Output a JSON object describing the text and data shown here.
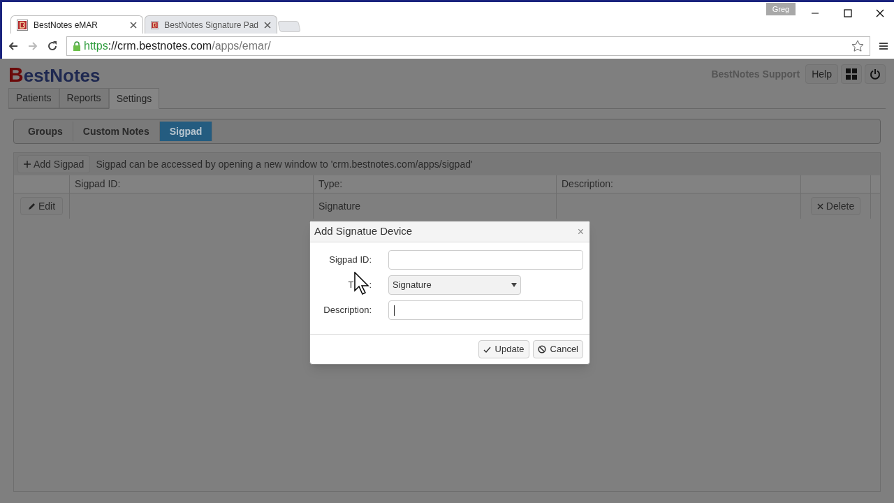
{
  "browser": {
    "tabs": [
      {
        "title": "BestNotes eMAR",
        "selected": true
      },
      {
        "title": "BestNotes Signature Pad",
        "selected": false
      }
    ],
    "profile": "Greg",
    "url_scheme": "https",
    "url_host": "://crm.bestnotes.com",
    "url_path": "/apps/emar/"
  },
  "app": {
    "logo_initial": "B",
    "logo_rest": "estNotes",
    "user": "BestNotes Support",
    "help": "Help",
    "tabs": [
      {
        "label": "Patients",
        "selected": false
      },
      {
        "label": "Reports",
        "selected": false
      },
      {
        "label": "Settings",
        "selected": true
      }
    ],
    "subtabs": [
      {
        "label": "Groups",
        "selected": false
      },
      {
        "label": "Custom Notes",
        "selected": false
      },
      {
        "label": "Sigpad",
        "selected": true
      }
    ],
    "add_button": "Add Sigpad",
    "info": "Sigpad can be accessed by opening a new window to 'crm.bestnotes.com/apps/sigpad'",
    "table": {
      "columns": [
        "Sigpad ID:",
        "Type:",
        "Description:"
      ],
      "rows": [
        {
          "edit": "Edit",
          "type": "Signature",
          "delete": "Delete"
        }
      ]
    }
  },
  "dialog": {
    "title": "Add Signatue Device",
    "close": "×",
    "fields": [
      {
        "kind": "text",
        "label": "Sigpad ID:"
      },
      {
        "kind": "select",
        "label": "T",
        "label_end": ":",
        "value": "Signature"
      },
      {
        "kind": "text",
        "label": "Description:"
      }
    ],
    "buttons": [
      {
        "kind": "update",
        "label": "Update"
      },
      {
        "kind": "cancel",
        "label": "Cancel"
      }
    ]
  }
}
